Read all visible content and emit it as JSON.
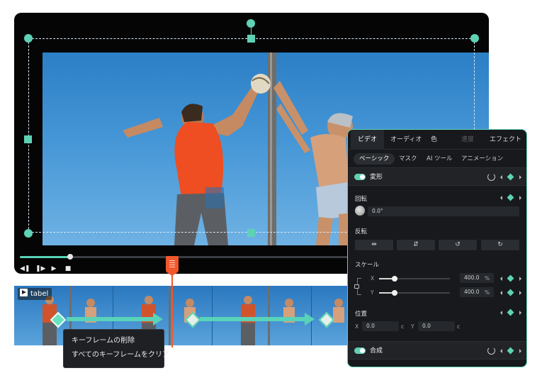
{
  "timeline": {
    "clip_name": "tabel",
    "playhead_progress": 0.14
  },
  "context_menu": {
    "items": [
      "キーフレームの削除",
      "すべてのキーフレームをクリア"
    ]
  },
  "panel": {
    "tabs": [
      "ビデオ",
      "オーディオ",
      "色",
      "速度",
      "エフェクト"
    ],
    "active_tab": "ビデオ",
    "subtabs": [
      "ベーシック",
      "マスク",
      "AI ツール",
      "アニメーション"
    ],
    "active_subtab": "ベーシック",
    "transform": {
      "title": "変形",
      "rotate_label": "回転",
      "rotate_value": "0.0°",
      "flip_label": "反転",
      "scale_label": "スケール",
      "scale_x_label": "X",
      "scale_x_value": "400.0",
      "scale_y_label": "Y",
      "scale_y_value": "400.0",
      "percent": "%",
      "position_label": "位置",
      "pos_x_label": "X",
      "pos_x_value": "0.0",
      "pos_y_label": "Y",
      "pos_y_value": "0.0",
      "unit": "c"
    },
    "compositing": {
      "title": "合成"
    }
  },
  "colors": {
    "accent": "#5fd2b5",
    "playhead": "#f2572b",
    "panel_bg": "#17191c"
  }
}
